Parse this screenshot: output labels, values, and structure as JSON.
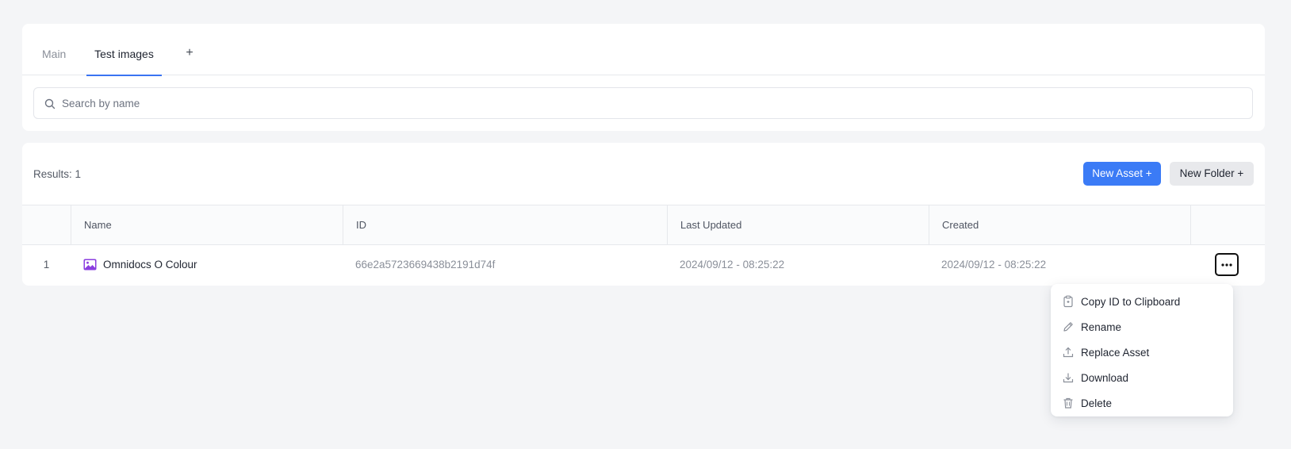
{
  "tabs": [
    {
      "label": "Main"
    },
    {
      "label": "Test images"
    },
    {
      "label": "+"
    }
  ],
  "search": {
    "placeholder": "Search by name",
    "value": "",
    "icon": "search-icon"
  },
  "results": {
    "count_label": "Results: 1",
    "new_asset_label": "New Asset +",
    "new_folder_label": "New Folder +"
  },
  "table": {
    "columns": [
      "",
      "Name",
      "ID",
      "Last Updated",
      "Created",
      ""
    ],
    "rows": [
      {
        "index": "1",
        "name": "Omnidocs O Colour",
        "icon": "image-icon",
        "id": "66e2a5723669438b2191d74f",
        "last_updated": "2024/09/12 - 08:25:22",
        "created": "2024/09/12 - 08:25:22"
      }
    ]
  },
  "context_menu": {
    "items": [
      {
        "label": "Copy ID to Clipboard",
        "icon": "clipboard-icon"
      },
      {
        "label": "Rename",
        "icon": "pencil-icon"
      },
      {
        "label": "Replace Asset",
        "icon": "upload-icon"
      },
      {
        "label": "Download",
        "icon": "download-icon"
      },
      {
        "label": "Delete",
        "icon": "trash-icon"
      }
    ]
  },
  "colors": {
    "accent": "#3b7bf6",
    "image_icon": "#8b3fe0",
    "background": "#f4f5f7"
  }
}
